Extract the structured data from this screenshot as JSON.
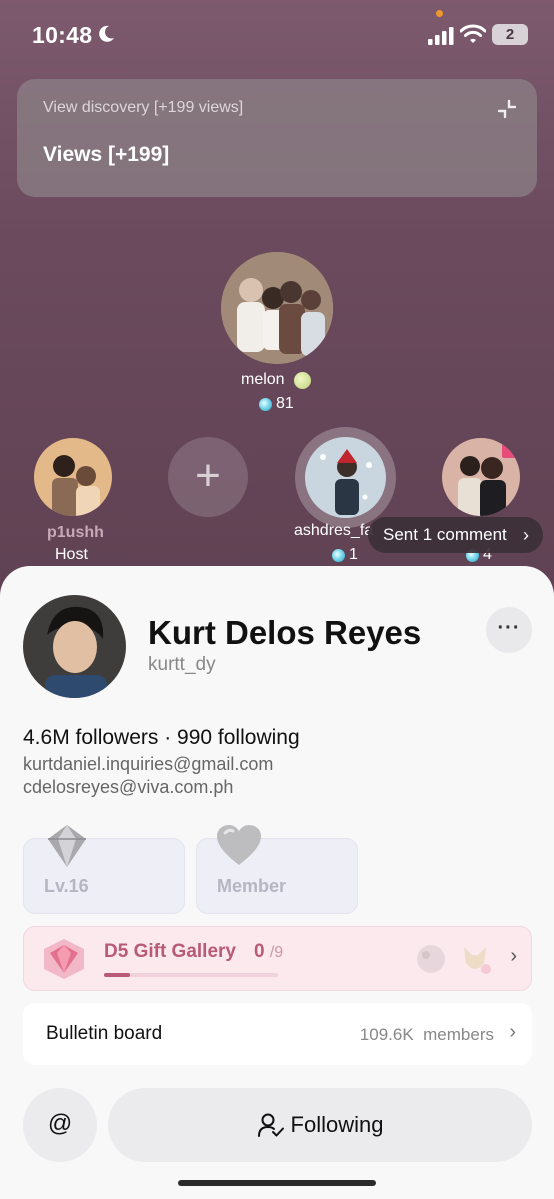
{
  "status_bar": {
    "time": "10:48",
    "battery": "2"
  },
  "banner": {
    "subtitle": "View discovery [+199 views]",
    "title": "Views [+199]"
  },
  "seats": {
    "top": {
      "name": "melon",
      "count": "81"
    },
    "host": {
      "name": "p1ushh",
      "role": "Host"
    },
    "add_label": "+",
    "guest": {
      "name": "ashdres_fa",
      "count": "1"
    },
    "right": {
      "count": "4"
    }
  },
  "toast": {
    "text": "Sent 1 comment"
  },
  "profile": {
    "name": "Kurt Delos Reyes",
    "handle": "kurtt_dy",
    "stats": "4.6M followers · 990 following",
    "email1": "kurtdaniel.inquiries@gmail.com",
    "email2": "cdelosreyes@viva.com.ph",
    "more": "···"
  },
  "badges": {
    "level": "Lv.16",
    "member": "Member"
  },
  "gift_gallery": {
    "title": "D5 Gift Gallery",
    "collected": "0",
    "total": "/9",
    "progress": 0.15
  },
  "bulletin": {
    "title": "Bulletin board",
    "count": "109.6K",
    "unit": "members"
  },
  "actions": {
    "mention": "@",
    "follow": "Following"
  }
}
